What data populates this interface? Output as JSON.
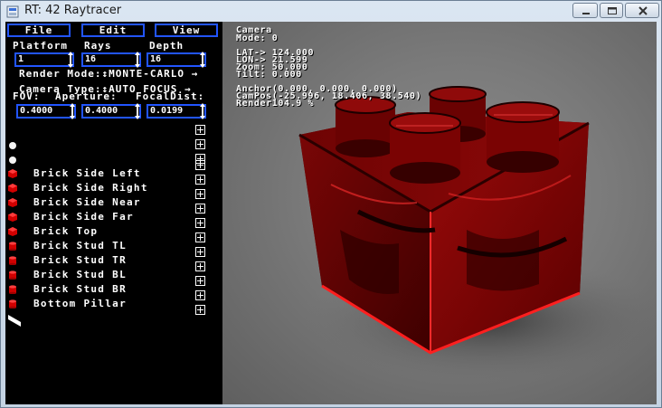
{
  "window": {
    "title": "RT: 42 Raytracer"
  },
  "menu": {
    "file": "File",
    "edit": "Edit",
    "view": "View"
  },
  "params": {
    "platform_label": "Platform",
    "rays_label": "Rays",
    "depth_label": "Depth",
    "platform_value": "1",
    "rays_value": "16",
    "depth_value": "16",
    "render_mode": "Render Mode:↕MONTE-CARLO →",
    "camera_type": "Camera Type:↕AUTO FOCUS →",
    "fov_label": "FOV:",
    "aperture_label": "Aperture:",
    "focal_label": "FocalDist:",
    "fov_value": "0.4000",
    "aperture_value": "0.4000",
    "focal_value": "0.0199"
  },
  "objects": [
    {
      "label": "",
      "icon": "white-sphere-icon"
    },
    {
      "label": "",
      "icon": "white-sphere-icon"
    },
    {
      "label": "Brick Side Left",
      "icon": "red-cube-icon"
    },
    {
      "label": "Brick Side Right",
      "icon": "red-cube-icon"
    },
    {
      "label": "Brick Side Near",
      "icon": "red-cube-icon"
    },
    {
      "label": "Brick Side Far",
      "icon": "red-cube-icon"
    },
    {
      "label": "Brick Top",
      "icon": "red-cube-icon"
    },
    {
      "label": "Brick Stud TL",
      "icon": "red-cylinder-icon"
    },
    {
      "label": "Brick Stud TR",
      "icon": "red-cylinder-icon"
    },
    {
      "label": "Brick Stud BL",
      "icon": "red-cylinder-icon"
    },
    {
      "label": "Brick Stud BR",
      "icon": "red-cylinder-icon"
    },
    {
      "label": "Bottom Pillar",
      "icon": "red-cylinder-icon"
    },
    {
      "label": "",
      "icon": "white-plane-icon"
    }
  ],
  "hud": {
    "line1": "Camera",
    "line2": "Mode: 0",
    "lat": "LAT-> 124.000",
    "lon": "LON-> 21.599",
    "zoom": "Zoom: 50.000",
    "tilt": "Tilt: 0.000",
    "anchor": "Anchor(0.000, 0.000, 0.000)",
    "campos": "CamPos(-25.996, 18.406, 38.540)",
    "render": "Render104.9 %"
  },
  "colors": {
    "accent": "#2255ff",
    "brick": "#a00000"
  }
}
